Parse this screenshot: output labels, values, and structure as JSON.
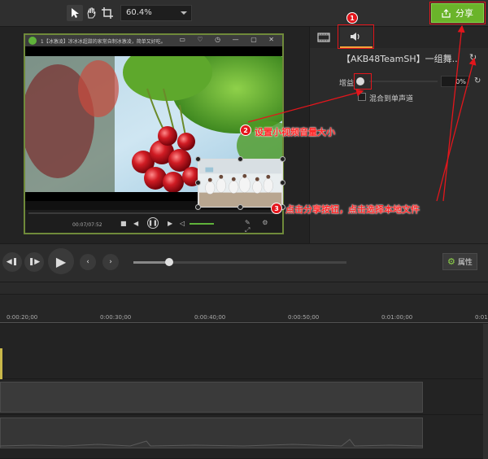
{
  "toolbar": {
    "zoom_value": "60.4%",
    "share_label": "分享"
  },
  "player": {
    "title": "1【冰激凌】凉冰冰超甜的家常自制冰激凌，简单又好吃。",
    "time": "00:07/07:52"
  },
  "properties_panel": {
    "clip_title": "【AKB48TeamSH】一组舞...",
    "gain_label": "增益",
    "gain_value": "0%",
    "mix_mono_label": "混合到单声道"
  },
  "playback": {
    "properties_label": "属性"
  },
  "timeline": {
    "ticks": [
      "0:00:20;00",
      "0:00:30;00",
      "0:00:40;00",
      "0:00:50;00",
      "0:01:00;00",
      "0:01"
    ]
  },
  "annotations": {
    "badge_1": "1",
    "badge_2": "2",
    "badge_3": "3",
    "step2_text": "设置小视频音量大小",
    "step3_text": "点击分享按钮，点击选择本地文件"
  },
  "colors": {
    "accent_green": "#6ab42a",
    "annotation_red": "#e3161c",
    "audio_tab_accent": "#f2a33a"
  },
  "icons": [
    "select-arrow-icon",
    "hand-icon",
    "crop-icon",
    "share-upload-icon",
    "video-tab-icon",
    "speaker-icon",
    "reset-icon",
    "gear-icon",
    "rewind-icon",
    "forward-icon",
    "play-icon",
    "prev-icon",
    "next-icon"
  ]
}
